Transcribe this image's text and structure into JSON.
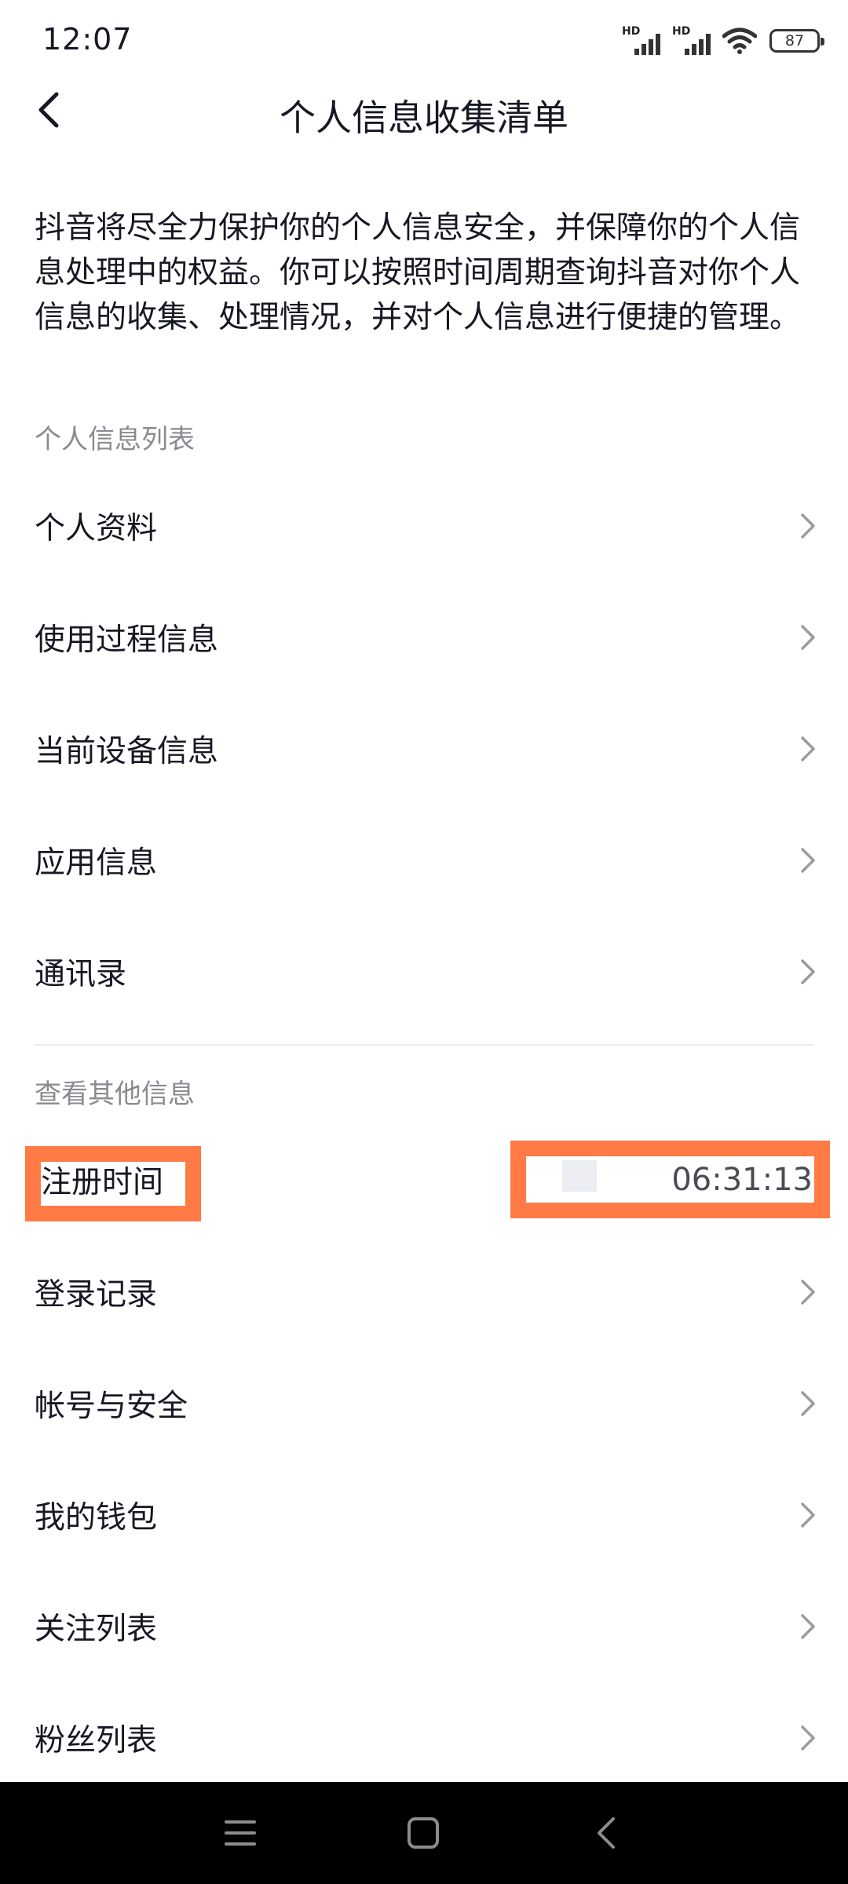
{
  "status_bar": {
    "time": "12:07",
    "battery_level": "87",
    "signal_1_label": "HD",
    "signal_2_label": "HD",
    "icons": [
      "hd-signal-icon",
      "hd-signal-icon",
      "wifi-icon",
      "battery-icon"
    ]
  },
  "header": {
    "title": "个人信息收集清单",
    "back_icon": "chevron-left-icon"
  },
  "intro_text": "抖音将尽全力保护你的个人信息安全，并保障你的个人信息处理中的权益。你可以按照时间周期查询抖音对你个人信息的收集、处理情况，并对个人信息进行便捷的管理。",
  "section_personal": {
    "label": "个人信息列表",
    "items": [
      {
        "label": "个人资料"
      },
      {
        "label": "使用过程信息"
      },
      {
        "label": "当前设备信息"
      },
      {
        "label": "应用信息"
      },
      {
        "label": "通讯录"
      }
    ]
  },
  "section_other": {
    "label": "查看其他信息",
    "register_time": {
      "label": "注册时间",
      "value": "06:31:13"
    },
    "items": [
      {
        "label": "登录记录"
      },
      {
        "label": "帐号与安全"
      },
      {
        "label": "我的钱包"
      },
      {
        "label": "关注列表"
      },
      {
        "label": "粉丝列表"
      }
    ]
  },
  "colors": {
    "highlight_border": "#ff7a45",
    "secondary_text": "#8a8b91",
    "primary_text": "#161823",
    "chevron": "#9b9ca2"
  },
  "system_nav": {
    "icons": [
      "menu-icon",
      "home-icon",
      "back-icon"
    ]
  }
}
